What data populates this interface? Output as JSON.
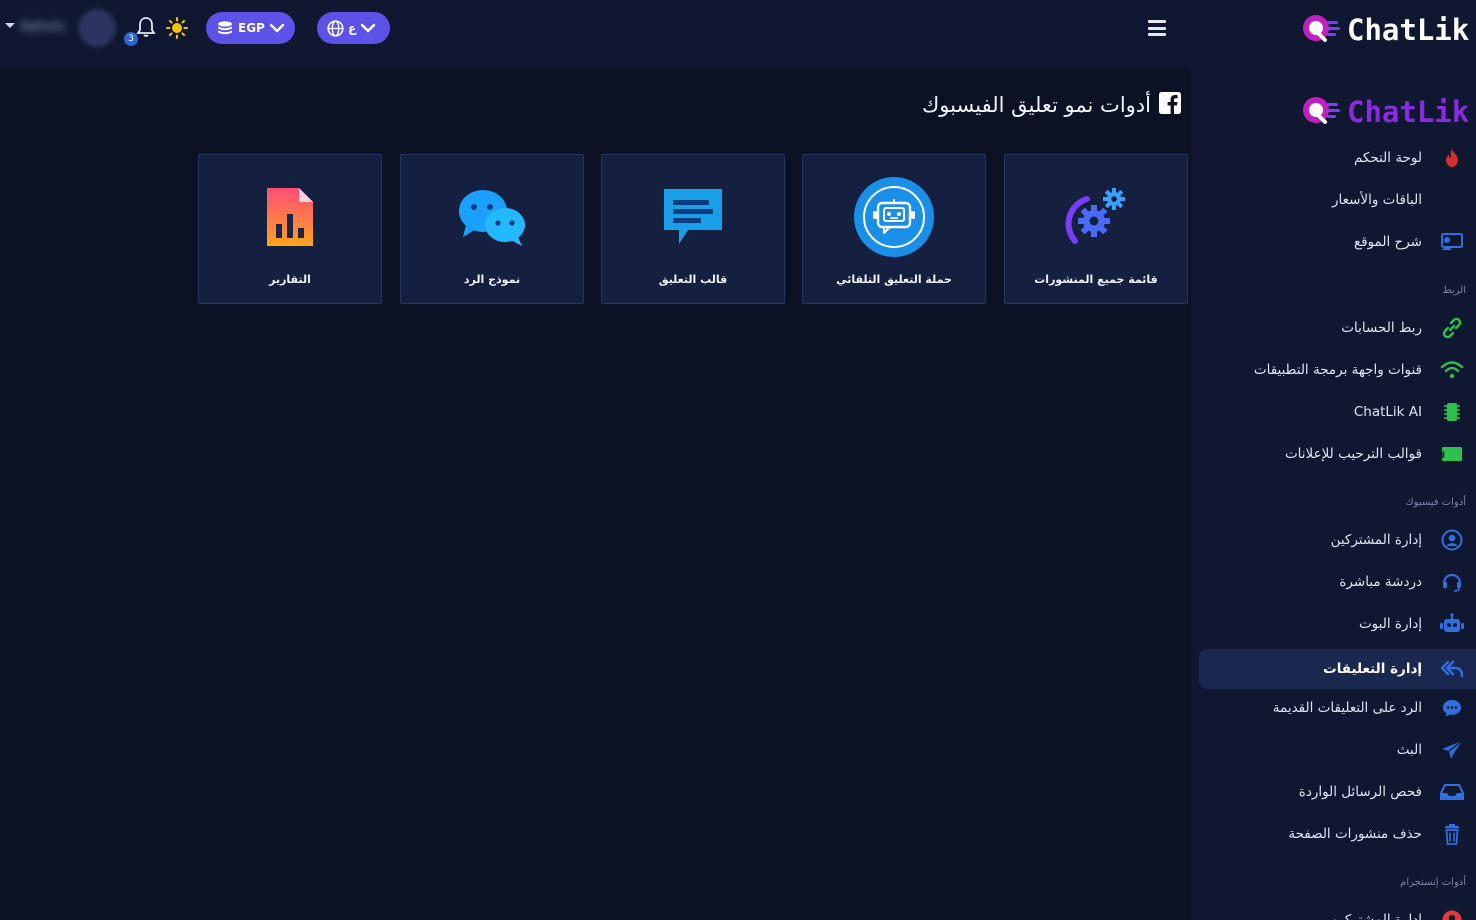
{
  "topbar": {
    "user_name": "Admin",
    "notification_count": "3",
    "currency_label": "EGP",
    "language_label": "ع"
  },
  "logo": {
    "brand": "ChatLik"
  },
  "sidebar": {
    "items": [
      {
        "label": "لوحة التحكم",
        "icon": "fire-icon",
        "color": "#e53935"
      },
      {
        "label": "الباقات والأسعار",
        "icon": "dollar-icon",
        "color": "#2f6fe0"
      },
      {
        "label": "شرح الموقع",
        "icon": "screen-share-icon",
        "color": "#2f6fe0"
      },
      {
        "label": "ربط الحسابات",
        "icon": "link-icon",
        "color": "#2ec04f"
      },
      {
        "label": "قنوات واجهة برمجة التطبيقات",
        "icon": "wifi-icon",
        "color": "#2ec04f"
      },
      {
        "label": "ChatLik AI",
        "icon": "chip-icon",
        "color": "#2ec04f"
      },
      {
        "label": "قوالب الترحيب للإعلانات",
        "icon": "ad-icon",
        "color": "#2ec04f"
      },
      {
        "label": "إدارة المشتركين",
        "icon": "user-circle-icon",
        "color": "#2f6fe0"
      },
      {
        "label": "دردشة مباشرة",
        "icon": "headset-icon",
        "color": "#2f6fe0"
      },
      {
        "label": "إدارة البوت",
        "icon": "robot-icon",
        "color": "#2f6fe0"
      },
      {
        "label": "إدارة التعليقات",
        "icon": "reply-all-icon",
        "color": "#2f6fe0"
      },
      {
        "label": "الرد على التعليقات القديمة",
        "icon": "comment-dots-icon",
        "color": "#2f6fe0"
      },
      {
        "label": "البث",
        "icon": "paper-plane-icon",
        "color": "#2f6fe0"
      },
      {
        "label": "فحص الرسائل الواردة",
        "icon": "inbox-icon",
        "color": "#2f6fe0"
      },
      {
        "label": "حذف منشورات الصفحة",
        "icon": "trash-icon",
        "color": "#2f6fe0"
      },
      {
        "label": "إدارة المشتركين",
        "icon": "user-circle-icon",
        "color": "#e53935"
      }
    ],
    "sections": {
      "link": "الربط",
      "facebook_tools": "أدوات فيسبوك",
      "instagram_tools": "أدوات إنستجرام"
    },
    "active_item": "إدارة التعليقات"
  },
  "main": {
    "title": "أدوات نمو تعليق الفيسبوك",
    "cards": [
      {
        "label": "قائمة جميع المنشورات",
        "icon": "gears-icon"
      },
      {
        "label": "حملة التعليق التلقائي",
        "icon": "robot-circle-icon"
      },
      {
        "label": "قالب التعليق",
        "icon": "comment-template-icon"
      },
      {
        "label": "نموذج الرد",
        "icon": "chat-bubbles-icon"
      },
      {
        "label": "التقارير",
        "icon": "report-file-icon"
      }
    ]
  },
  "colors": {
    "background": "#0c1224",
    "panel": "#0f1830",
    "card": "#152041",
    "accent_purple": "#5c52e8",
    "brand_purple": "#8a2be2"
  }
}
